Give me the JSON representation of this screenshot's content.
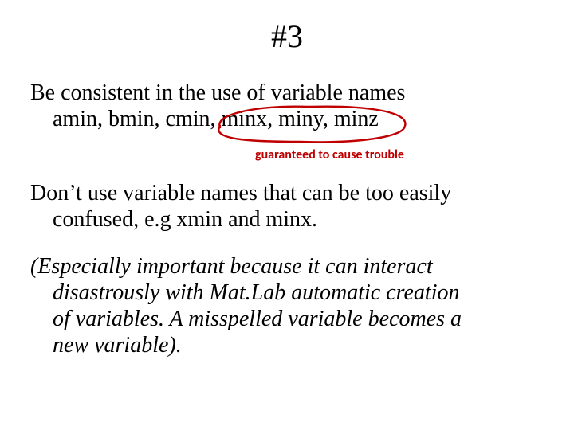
{
  "title": "#3",
  "p1_line1": "Be consistent in the use of variable names",
  "p1_line2": "amin, bmin, cmin, minx, miny, minz",
  "annotation": "guaranteed to cause trouble",
  "p2_line1": "Don’t use variable names that can be too easily",
  "p2_line2": "confused, e.g xmin and minx.",
  "p3_line1": "(Especially important because it can interact",
  "p3_line2": "disastrously with Mat.Lab automatic creation",
  "p3_line3": "of variables. A misspelled variable becomes a",
  "p3_line4": "new variable).",
  "circle_color": "#c00000"
}
